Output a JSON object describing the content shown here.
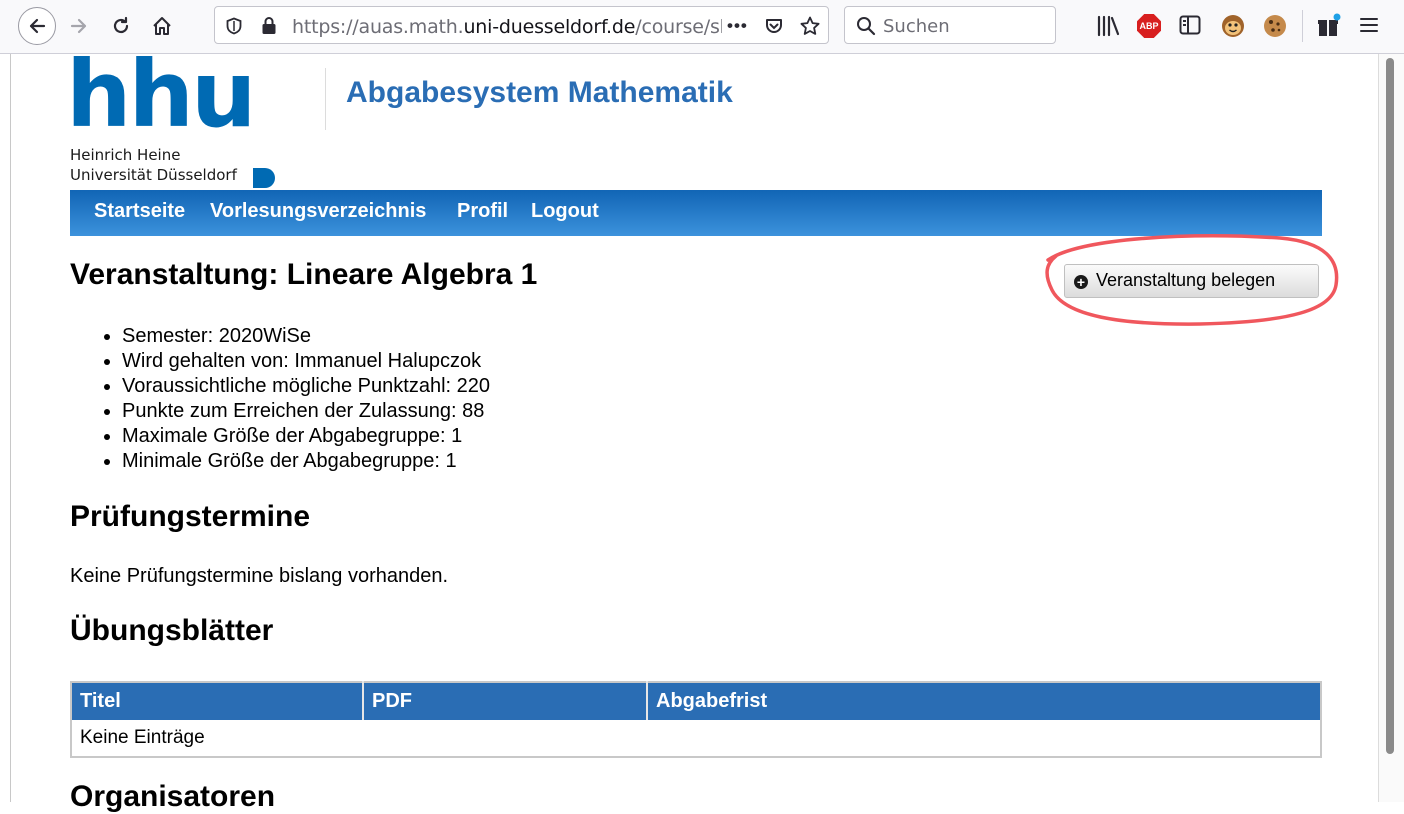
{
  "browser": {
    "url_prefix": "https://auas.math.",
    "url_host": "uni-duesseldorf.de",
    "url_suffix": "/course/sho",
    "search_placeholder": "Suchen",
    "more_label": "•••"
  },
  "header": {
    "logo_text": "hhu",
    "logo_line1": "Heinrich Heine",
    "logo_line2": "Universität Düsseldorf",
    "site_title": "Abgabesystem Mathematik"
  },
  "nav": {
    "items": [
      {
        "label": "Startseite"
      },
      {
        "label": "Vorlesungsverzeichnis"
      },
      {
        "label": "Profil"
      },
      {
        "label": "Logout"
      }
    ]
  },
  "course": {
    "title": "Veranstaltung: Lineare Algebra 1",
    "enroll_label": "Veranstaltung belegen",
    "details": [
      "Semester: 2020WiSe",
      "Wird gehalten von: Immanuel Halupczok",
      "Voraussichtliche mögliche Punktzahl: 220",
      "Punkte zum Erreichen der Zulassung: 88",
      "Maximale Größe der Abgabegruppe: 1",
      "Minimale Größe der Abgabegruppe: 1"
    ]
  },
  "exams": {
    "heading": "Prüfungstermine",
    "empty_text": "Keine Prüfungstermine bislang vorhanden."
  },
  "sheets": {
    "heading": "Übungsblätter",
    "columns": [
      "Titel",
      "PDF",
      "Abgabefrist"
    ],
    "empty_text": "Keine Einträge"
  },
  "organizers": {
    "heading": "Organisatoren"
  },
  "colors": {
    "brand_blue": "#2a6db4",
    "annotation_red": "#f0575d"
  }
}
